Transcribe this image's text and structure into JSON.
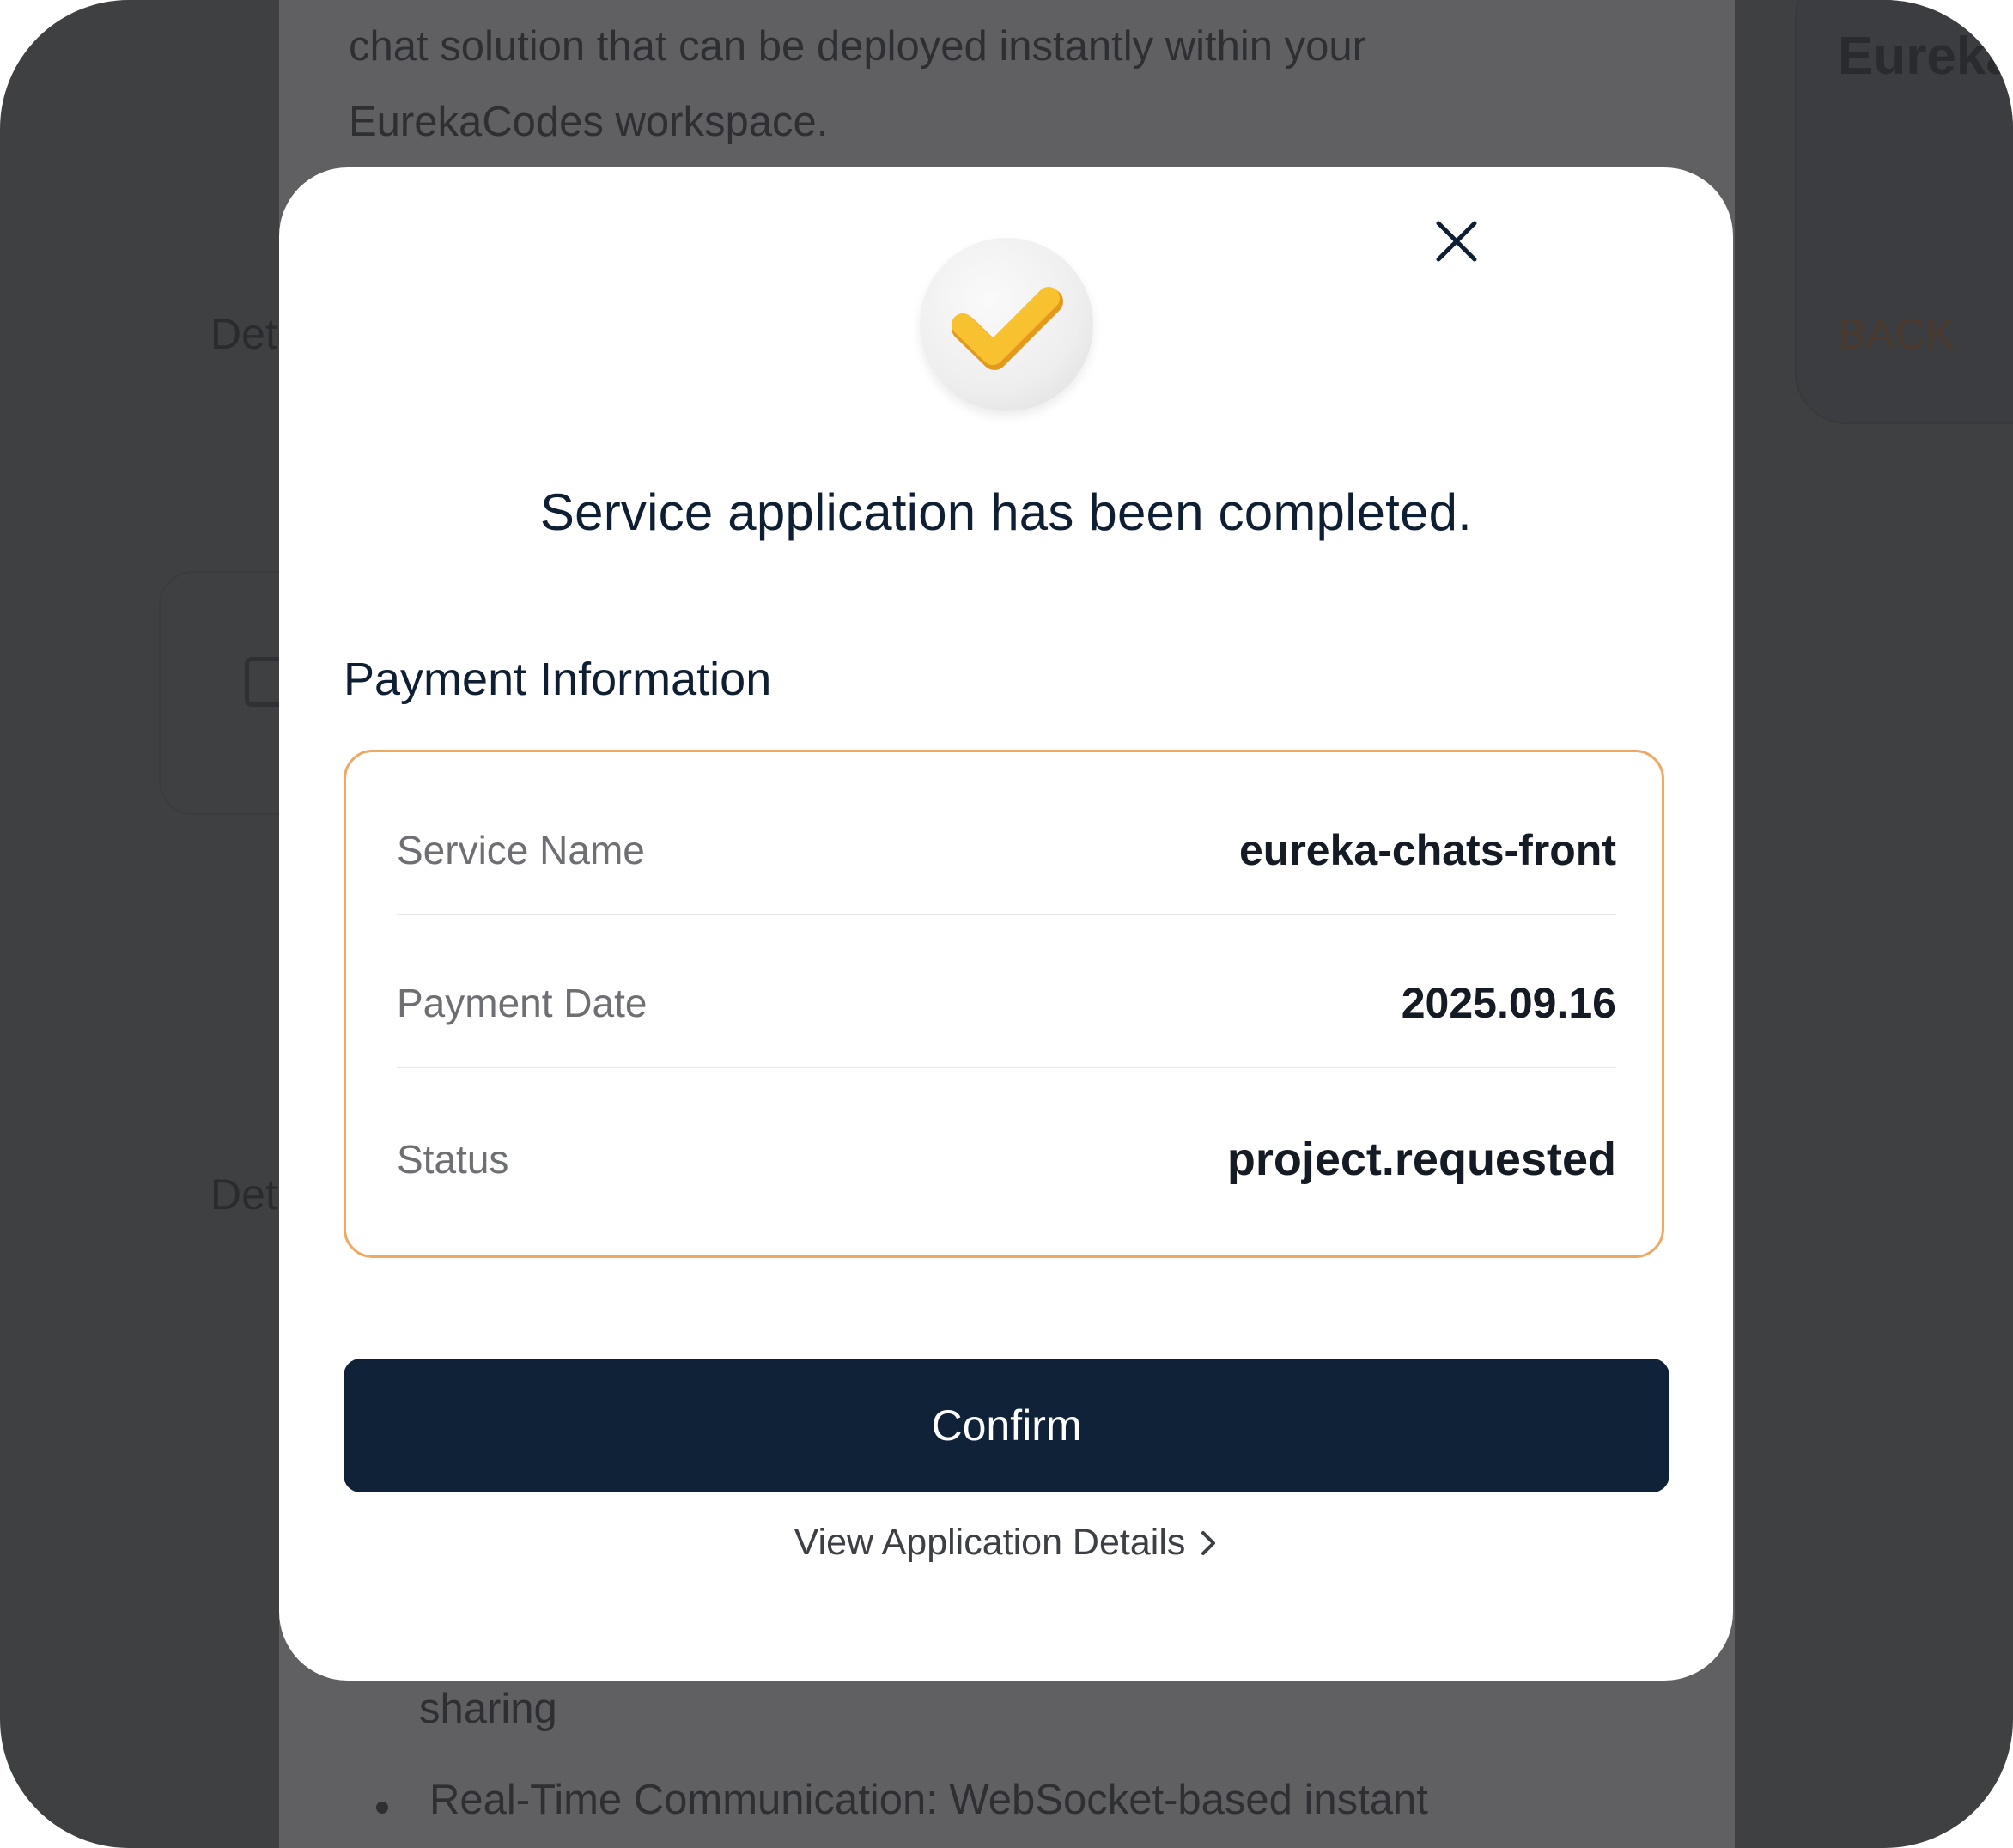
{
  "background": {
    "description_lines": [
      "chat solution that can be deployed instantly within your",
      "EurekaCodes workspace."
    ],
    "right_panel_title": "Eureka",
    "back_label": "BACK",
    "detail_label_1": "Det",
    "detail_label_2": "Det",
    "list_fragment": "sharing",
    "list_item": "Real-Time Communication: WebSocket-based instant"
  },
  "modal": {
    "close_icon": "close-icon",
    "success_icon": "checkmark-icon",
    "accent_color": "#f5b833",
    "headline": "Service application has been completed.",
    "section_title": "Payment Information",
    "border_color": "#f0a863",
    "rows": [
      {
        "label": "Service Name",
        "value": "eureka-chats-front"
      },
      {
        "label": "Payment Date",
        "value": "2025.09.16"
      },
      {
        "label": "Status",
        "value": "project.requested"
      }
    ],
    "confirm_label": "Confirm",
    "button_color": "#0f2238",
    "details_link_label": "View Application Details"
  }
}
